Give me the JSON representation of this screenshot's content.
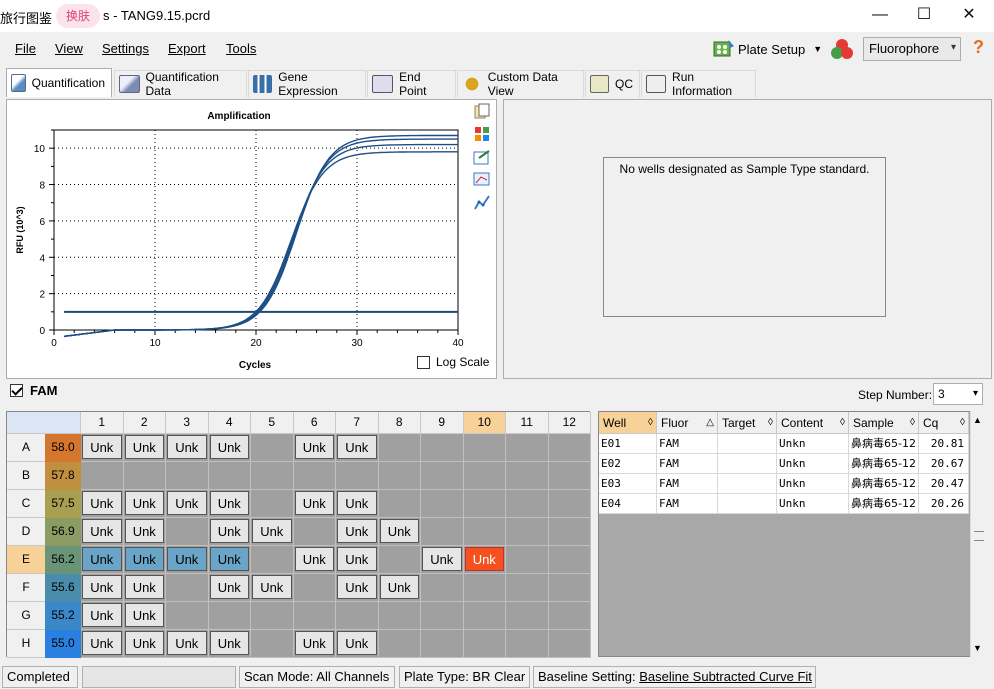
{
  "titlebar": {
    "app_prefix": "旅行图鉴",
    "skin_label": "换肤",
    "file_title": "s - TANG9.15.pcrd",
    "minimize": "—",
    "maximize": "☐",
    "close": "✕"
  },
  "menu": {
    "file": "File",
    "view": "View",
    "settings": "Settings",
    "export": "Export",
    "tools": "Tools",
    "plate_setup": "Plate Setup",
    "fluorophore": "Fluorophore",
    "help": "?"
  },
  "tabs": [
    {
      "label": "Quantification",
      "active": true
    },
    {
      "label": "Quantification Data"
    },
    {
      "label": "Gene Expression"
    },
    {
      "label": "End Point"
    },
    {
      "label": "Custom Data View"
    },
    {
      "label": "QC"
    },
    {
      "label": "Run Information"
    }
  ],
  "chart_data": {
    "type": "line",
    "title": "Amplification",
    "xlabel": "Cycles",
    "ylabel": "RFU (10^3)",
    "xlim": [
      0,
      40
    ],
    "ylim": [
      0,
      11
    ],
    "xticks": [
      0,
      10,
      20,
      30,
      40
    ],
    "yticks": [
      0,
      2,
      4,
      6,
      8,
      10
    ],
    "grid": true,
    "threshold": 1.0,
    "series": [
      {
        "well": "E01",
        "plateau": 10.7,
        "cq": 20.81
      },
      {
        "well": "E02",
        "plateau": 10.5,
        "cq": 20.67
      },
      {
        "well": "E03",
        "plateau": 10.2,
        "cq": 20.47
      },
      {
        "well": "E04",
        "plateau": 9.8,
        "cq": 20.26
      }
    ]
  },
  "log_scale_label": "Log Scale",
  "std_message": "No wells designated as Sample Type standard.",
  "fam_label": "FAM",
  "step_number": {
    "label": "Step Number:",
    "value": "3"
  },
  "plate": {
    "columns": [
      "1",
      "2",
      "3",
      "4",
      "5",
      "6",
      "7",
      "8",
      "9",
      "10",
      "11",
      "12"
    ],
    "rows": [
      {
        "id": "A",
        "temp": "58.0",
        "color": "#d4762e",
        "wells": [
          "Unk",
          "Unk",
          "Unk",
          "Unk",
          "",
          "Unk",
          "Unk",
          "",
          "",
          "",
          "",
          ""
        ]
      },
      {
        "id": "B",
        "temp": "57.8",
        "color": "#c09040",
        "wells": [
          "",
          "",
          "",
          "",
          "",
          "",
          "",
          "",
          "",
          "",
          "",
          ""
        ]
      },
      {
        "id": "C",
        "temp": "57.5",
        "color": "#a8a050",
        "wells": [
          "Unk",
          "Unk",
          "Unk",
          "Unk",
          "",
          "Unk",
          "Unk",
          "",
          "",
          "",
          "",
          ""
        ]
      },
      {
        "id": "D",
        "temp": "56.9",
        "color": "#8a9c64",
        "wells": [
          "Unk",
          "Unk",
          "",
          "Unk",
          "Unk",
          "",
          "Unk",
          "Unk",
          "",
          "",
          "",
          ""
        ]
      },
      {
        "id": "E",
        "temp": "56.2",
        "color": "#6a9478",
        "wells": [
          "Unk",
          "Unk",
          "Unk",
          "Unk",
          "",
          "Unk",
          "Unk",
          "",
          "Unk",
          "Unk",
          "",
          ""
        ]
      },
      {
        "id": "F",
        "temp": "55.6",
        "color": "#4a8cac",
        "wells": [
          "Unk",
          "Unk",
          "",
          "Unk",
          "Unk",
          "",
          "Unk",
          "Unk",
          "",
          "",
          "",
          ""
        ]
      },
      {
        "id": "G",
        "temp": "55.2",
        "color": "#3a88c8",
        "wells": [
          "Unk",
          "Unk",
          "",
          "",
          "",
          "",
          "",
          "",
          "",
          "",
          "",
          ""
        ]
      },
      {
        "id": "H",
        "temp": "55.0",
        "color": "#2a80e0",
        "wells": [
          "Unk",
          "Unk",
          "Unk",
          "Unk",
          "",
          "Unk",
          "Unk",
          "",
          "",
          "",
          "",
          ""
        ]
      }
    ],
    "selected_row": "E",
    "highlight_col": "10"
  },
  "table": {
    "headers": [
      "Well",
      "Fluor",
      "Target",
      "Content",
      "Sample",
      "Cq"
    ],
    "rows": [
      [
        "E01",
        "FAM",
        "",
        "Unkn",
        "鼻病毒65-12",
        "20.81"
      ],
      [
        "E02",
        "FAM",
        "",
        "Unkn",
        "鼻病毒65-12",
        "20.67"
      ],
      [
        "E03",
        "FAM",
        "",
        "Unkn",
        "鼻病毒65-12",
        "20.47"
      ],
      [
        "E04",
        "FAM",
        "",
        "Unkn",
        "鼻病毒65-12",
        "20.26"
      ]
    ]
  },
  "status": {
    "completed": "Completed",
    "scan_mode": "Scan Mode: All Channels",
    "plate_type": "Plate Type: BR Clear",
    "baseline_prefix": "Baseline Setting: ",
    "baseline_value": "Baseline Subtracted Curve Fit"
  }
}
